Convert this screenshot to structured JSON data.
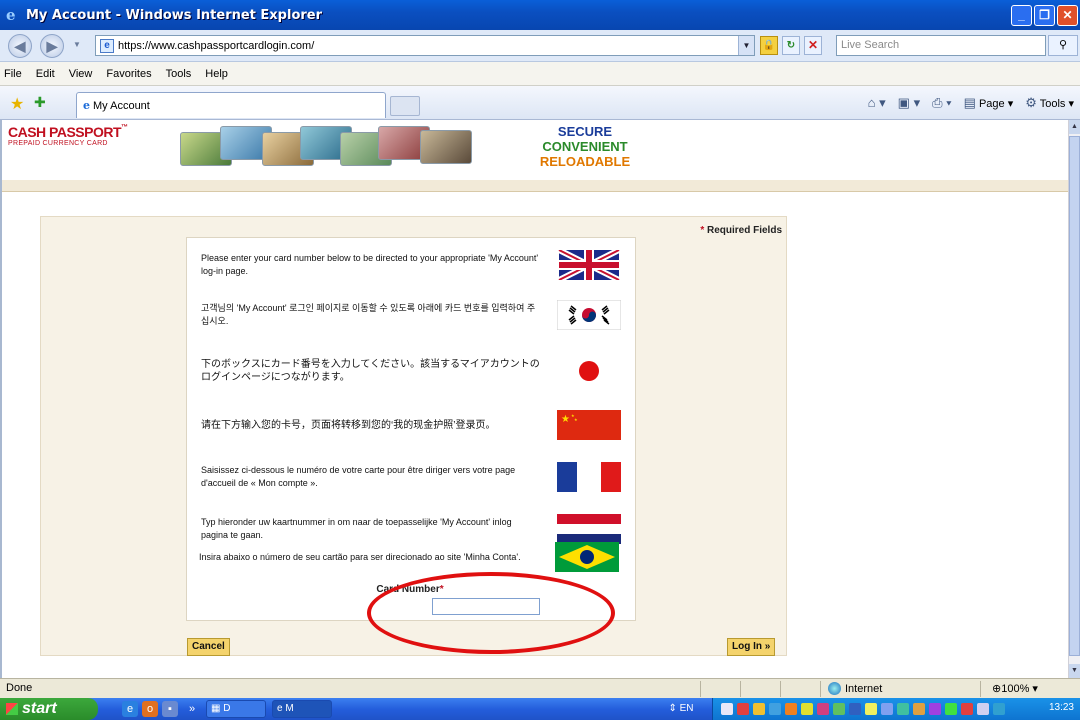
{
  "window": {
    "title": "My Account - Windows Internet Explorer"
  },
  "address_bar": {
    "url": "https://www.cashpassportcardlogin.com/",
    "search_placeholder": "Live Search"
  },
  "menu": [
    "File",
    "Edit",
    "View",
    "Favorites",
    "Tools",
    "Help"
  ],
  "tab": {
    "label": "My Account"
  },
  "toolbar": {
    "page_label": "Page",
    "tools_label": "Tools"
  },
  "site": {
    "brand_name": "CASH PASSPORT",
    "brand_tm": "™",
    "brand_sub": "PREPAID CURRENCY CARD",
    "taglines": [
      "SECURE",
      "CONVENIENT",
      "RELOADABLE"
    ],
    "colors": {
      "brand_red": "#c01020",
      "secure": "#1a3c9a",
      "convenient": "#2a8a2a",
      "reloadable": "#e07800"
    }
  },
  "form": {
    "required_fields": "Required Fields",
    "languages": [
      {
        "lang": "en",
        "flag": "uk-flag",
        "text": "Please enter your card number below to be directed to your appropriate 'My Account' log-in page."
      },
      {
        "lang": "ko",
        "flag": "korea-flag",
        "text": "고객님의 'My Account' 로그인 페이지로 이동할 수 있도록 아래에 카드 번호를 입력하여 주십시오."
      },
      {
        "lang": "ja",
        "flag": "japan-flag",
        "text": "下のボックスにカード番号を入力してください。該当するマイアカウントのログインページにつながります。"
      },
      {
        "lang": "zh",
        "flag": "china-flag",
        "text": "请在下方输入您的卡号，页面将转移到您的‘我的现金护照’登录页。"
      },
      {
        "lang": "fr",
        "flag": "france-flag",
        "text": "Saisissez ci-dessous le numéro de votre carte pour être diriger vers votre page d'accueil de « Mon compte »."
      },
      {
        "lang": "nl",
        "flag": "netherlands-flag",
        "text": "Typ hieronder uw kaartnummer in om naar de toepasselijke 'My Account' inlog pagina te gaan."
      },
      {
        "lang": "pt",
        "flag": "brazil-flag",
        "text": "Insira abaixo o número de seu cartão para ser direcionado ao site 'Minha Conta'."
      }
    ],
    "card_number_label": "Card Number",
    "card_number_value": "",
    "cancel_label": "Cancel",
    "login_label": "Log In »"
  },
  "status_bar": {
    "status": "Done",
    "zone": "Internet",
    "zoom": "100%"
  },
  "taskbar": {
    "start_label": "start",
    "task1_label": "D",
    "task2_label": "M",
    "language": "EN",
    "clock": "13:23"
  }
}
